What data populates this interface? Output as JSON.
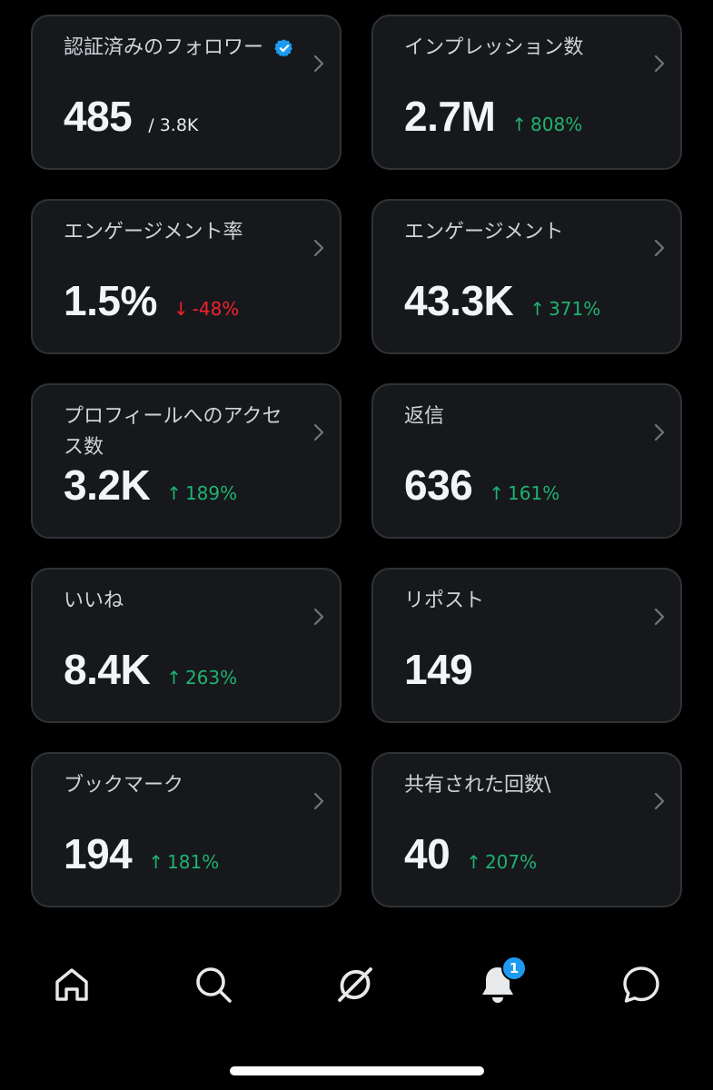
{
  "cards": [
    {
      "title": "認証済みのフォロワー",
      "value": "485",
      "sub": "/ 3.8K",
      "verified": true
    },
    {
      "title": "インプレッション数",
      "value": "2.7M",
      "delta": "808%",
      "trend": "up"
    },
    {
      "title": "エンゲージメント率",
      "value": "1.5%",
      "delta": "-48%",
      "trend": "down"
    },
    {
      "title": "エンゲージメント",
      "value": "43.3K",
      "delta": "371%",
      "trend": "up"
    },
    {
      "title": "プロフィールへのアクセス数",
      "value": "3.2K",
      "delta": "189%",
      "trend": "up"
    },
    {
      "title": "返信",
      "value": "636",
      "delta": "161%",
      "trend": "up"
    },
    {
      "title": "いいね",
      "value": "8.4K",
      "delta": "263%",
      "trend": "up"
    },
    {
      "title": "リポスト",
      "value": "149"
    },
    {
      "title": "ブックマーク",
      "value": "194",
      "delta": "181%",
      "trend": "up"
    },
    {
      "title": "共有された回数\\",
      "value": "40",
      "delta": "207%",
      "trend": "up"
    }
  ],
  "arrows": {
    "up": "↑",
    "down": "↓"
  },
  "nav": {
    "items": [
      "home-icon",
      "search-icon",
      "grok-icon",
      "bell-icon",
      "chat-bubble-icon"
    ],
    "notification_count": "1"
  },
  "colors": {
    "background": "#000000",
    "card": "#16181c",
    "card_border": "#2f3336",
    "up": "#1fb270",
    "down": "#f4212e",
    "verified": "#1d9bf0"
  }
}
